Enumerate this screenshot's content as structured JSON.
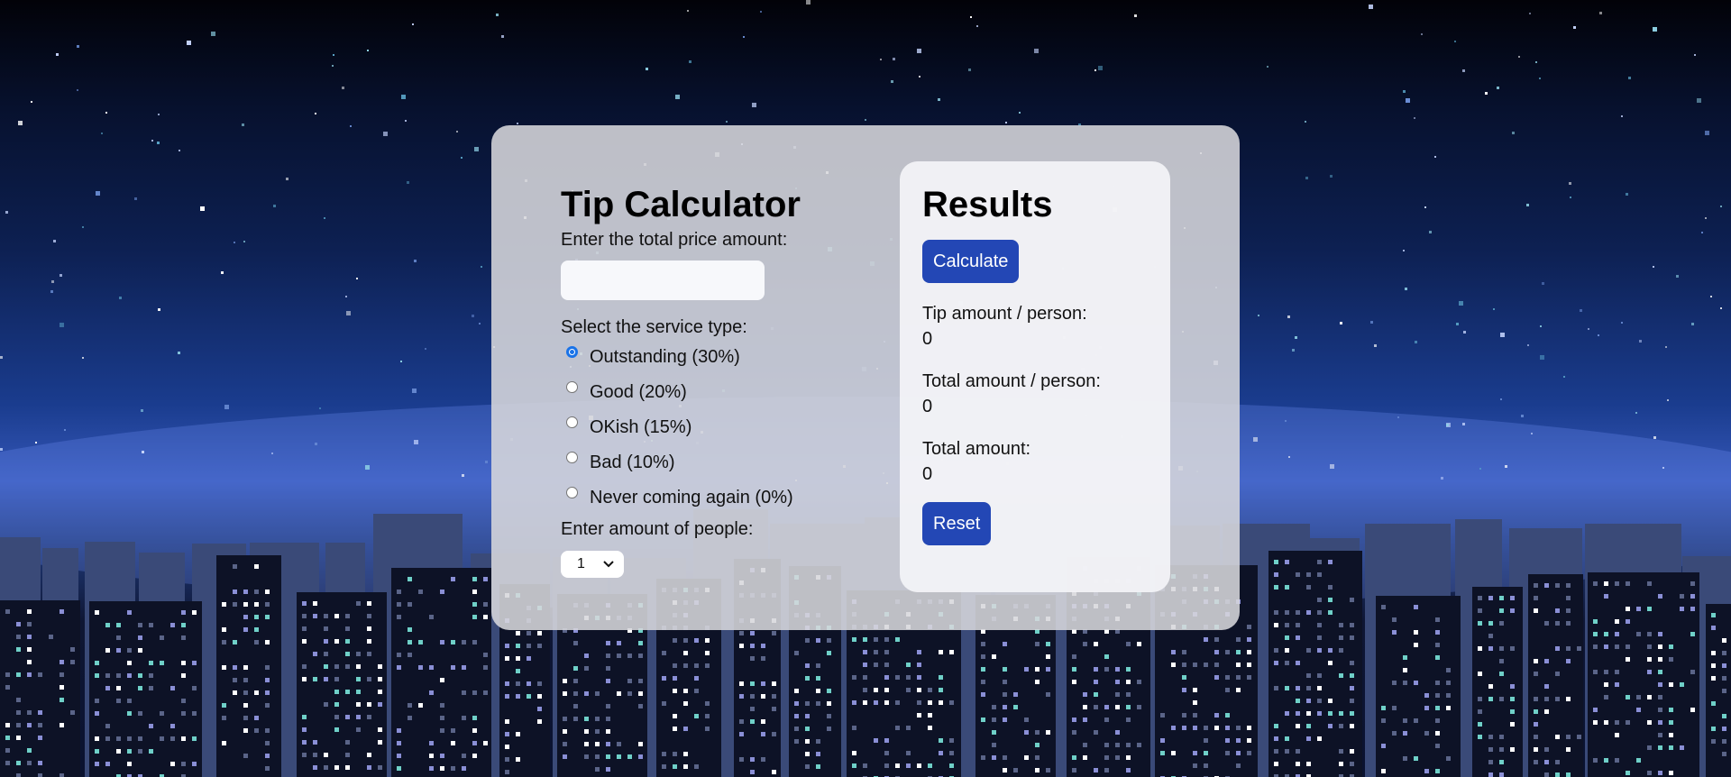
{
  "calculator": {
    "title": "Tip Calculator",
    "price_label": "Enter the total price amount:",
    "price_value": "",
    "service_label": "Select the service type:",
    "service_options": [
      {
        "label": "Outstanding (30%)",
        "checked": true
      },
      {
        "label": "Good (20%)",
        "checked": false
      },
      {
        "label": "OKish (15%)",
        "checked": false
      },
      {
        "label": "Bad (10%)",
        "checked": false
      },
      {
        "label": "Never coming again (0%)",
        "checked": false
      }
    ],
    "people_label": "Enter amount of people:",
    "people_selected": "1"
  },
  "results": {
    "title": "Results",
    "calculate_label": "Calculate",
    "tip_per_person_label": "Tip amount / person:",
    "tip_per_person_value": "0",
    "total_per_person_label": "Total amount / person:",
    "total_per_person_value": "0",
    "total_label": "Total amount:",
    "total_value": "0",
    "reset_label": "Reset"
  },
  "colors": {
    "accent": "#2347b5",
    "radio_checked": "#1a73e8"
  }
}
